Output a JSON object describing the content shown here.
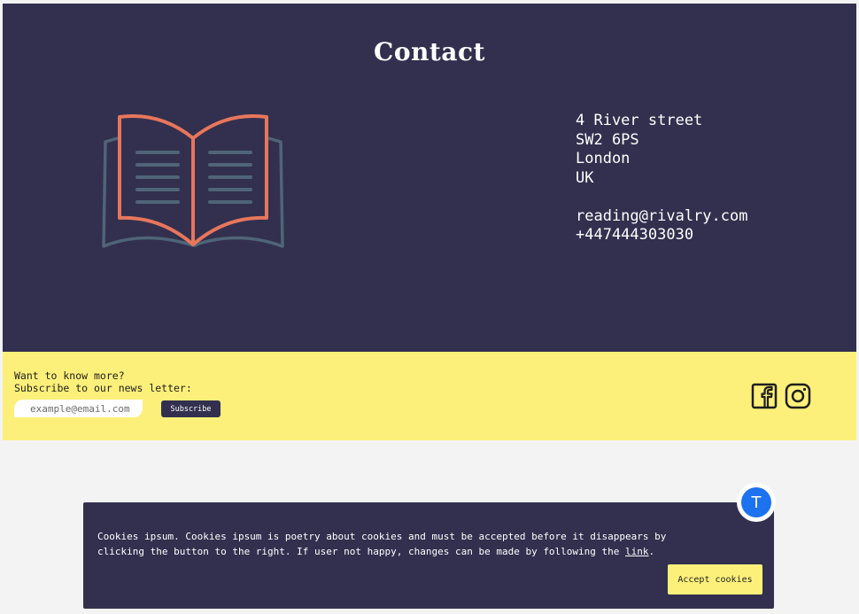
{
  "contact": {
    "title": "Contact",
    "address_lines": [
      "4 River street",
      "SW2 6PS",
      "London",
      "UK"
    ],
    "email": "reading@rivalry.com",
    "phone": "+447444303030"
  },
  "newsletter": {
    "prompt_line1": "Want to know more?",
    "prompt_line2": "Subscribe to our news letter:",
    "email_placeholder": "example@email.com",
    "subscribe_label": "Subscribe"
  },
  "social": {
    "icons": [
      "facebook-icon",
      "instagram-icon"
    ]
  },
  "cookie_banner": {
    "text_before_link": "Cookies ipsum. Cookies ipsum is poetry about cookies and must be accepted before it disappears by clicking the button to the right. If user not happy, changes can be made  by following the ",
    "link_label": "link",
    "text_after_link": ".",
    "accept_label": "Accept cookies"
  },
  "avatar": {
    "initial": "T"
  },
  "colors": {
    "navy": "#32304e",
    "yellow": "#fdf07a",
    "book_orange": "#e8765c",
    "book_slate": "#4f6479",
    "avatar_blue": "#1d72f0"
  }
}
